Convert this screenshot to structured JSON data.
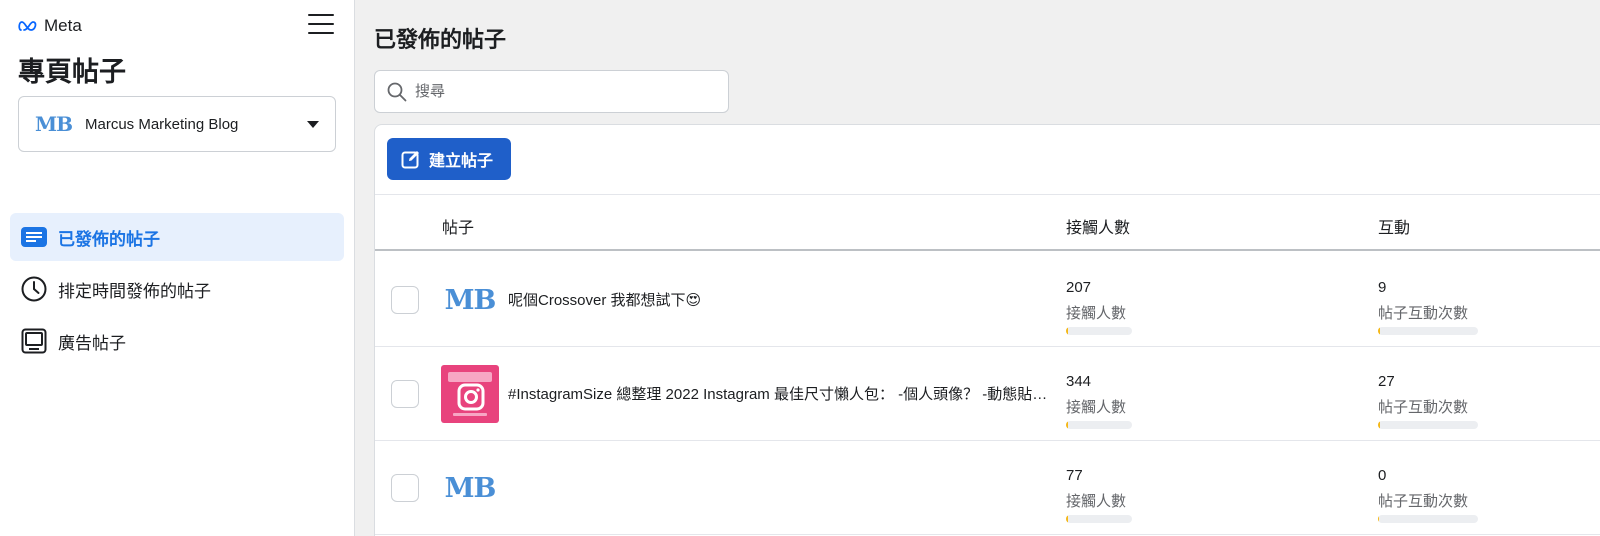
{
  "brand": {
    "logo_text": "Meta"
  },
  "sidebar": {
    "title": "專頁帖子",
    "page_selector": {
      "logo": "MB",
      "name": "Marcus Marketing Blog"
    },
    "nav": [
      {
        "label": "已發佈的帖子",
        "icon": "list-icon",
        "active": true
      },
      {
        "label": "排定時間發佈的帖子",
        "icon": "clock-icon",
        "active": false
      },
      {
        "label": "廣告帖子",
        "icon": "ad-screen-icon",
        "active": false
      }
    ]
  },
  "main": {
    "title": "已發佈的帖子",
    "search": {
      "placeholder": "搜尋"
    },
    "create_button": "建立帖子",
    "columns": {
      "post": "帖子",
      "reach": "接觸人數",
      "engagement": "互動"
    },
    "rows": [
      {
        "thumb": "MB",
        "text": "呢個Crossover 我都想試下😍",
        "reach": "207",
        "reach_label": "接觸人數",
        "reach_fill": 0.03,
        "engagement": "9",
        "engagement_label": "帖子互動次數",
        "engagement_fill": 0.02
      },
      {
        "thumb": "instagram-thumbnail",
        "text": "#InstagramSize 總整理 2022 Instagram 最佳尺寸懶人包： -個人頭像？ -動態貼文？ -限時動態？",
        "reach": "344",
        "reach_label": "接觸人數",
        "reach_fill": 0.03,
        "engagement": "27",
        "engagement_label": "帖子互動次數",
        "engagement_fill": 0.02
      },
      {
        "thumb": "MB",
        "text": "",
        "reach": "77",
        "reach_label": "接觸人數",
        "reach_fill": 0.03,
        "engagement": "0",
        "engagement_label": "帖子互動次數",
        "engagement_fill": 0.01
      }
    ]
  },
  "colors": {
    "accent": "#1b74e4",
    "button": "#1f5fc9",
    "bar_fill": "#f5b818",
    "ig_pink": "#e8437d",
    "mb_blue": "#4a8fd6"
  }
}
